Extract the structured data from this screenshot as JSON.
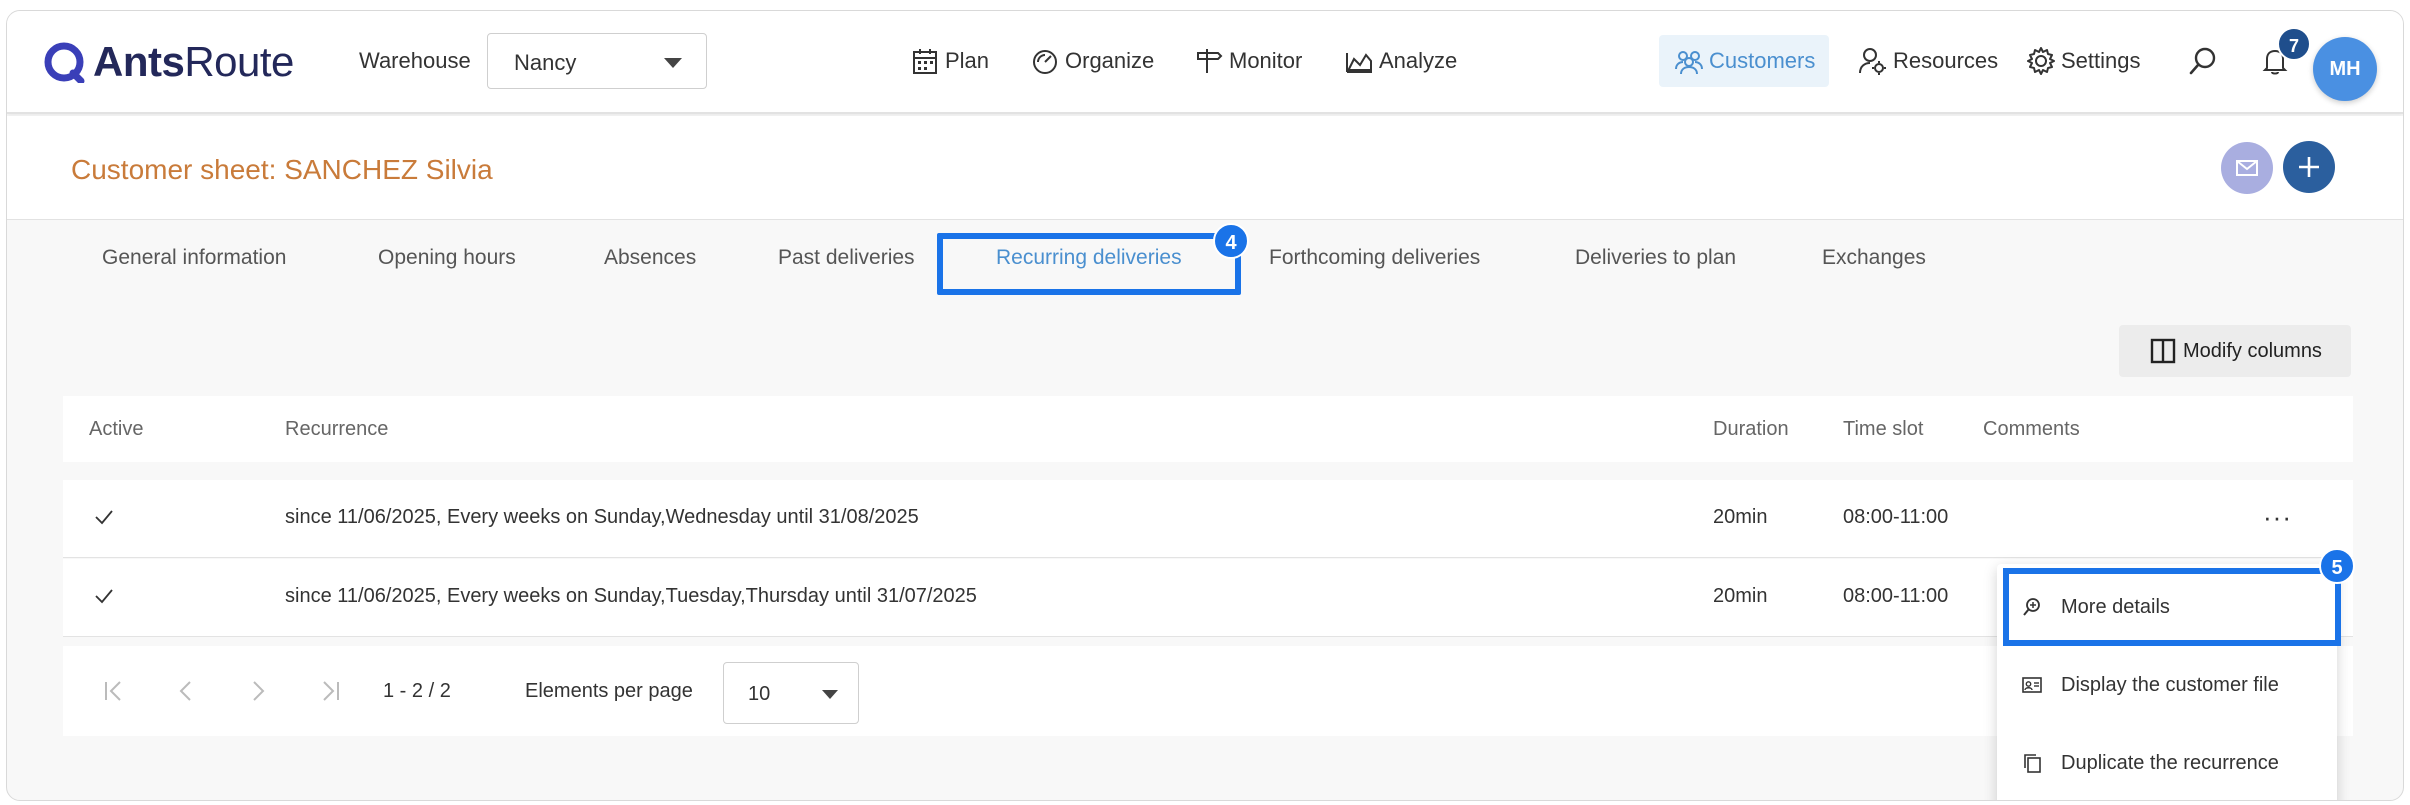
{
  "navbar": {
    "logo_bold": "Ants",
    "logo_light": "Route",
    "warehouse_label": "Warehouse",
    "warehouse_value": "Nancy",
    "items": [
      {
        "label": "Plan",
        "icon": "calendar-icon"
      },
      {
        "label": "Organize",
        "icon": "gauge-icon"
      },
      {
        "label": "Monitor",
        "icon": "signpost-icon"
      },
      {
        "label": "Analyze",
        "icon": "area-chart-icon"
      },
      {
        "label": "Customers",
        "icon": "users-icon"
      },
      {
        "label": "Resources",
        "icon": "user-gear-icon"
      },
      {
        "label": "Settings",
        "icon": "gear-icon"
      }
    ],
    "notification_count": "7",
    "avatar_initials": "MH"
  },
  "sheet": {
    "title": "Customer sheet: SANCHEZ Silvia"
  },
  "tabs": [
    "General information",
    "Opening hours",
    "Absences",
    "Past deliveries",
    "Recurring deliveries",
    "Forthcoming deliveries",
    "Deliveries to plan",
    "Exchanges"
  ],
  "active_tab": "Recurring deliveries",
  "markers": {
    "tab": "4",
    "menu": "5"
  },
  "modify_columns_label": "Modify columns",
  "table": {
    "columns": [
      "Active",
      "Recurrence",
      "Duration",
      "Time slot",
      "Comments"
    ],
    "rows": [
      {
        "active": true,
        "recurrence": "since 11/06/2025, Every weeks on Sunday,Wednesday until 31/08/2025",
        "duration": "20min",
        "time_slot": "08:00-11:00",
        "comments": ""
      },
      {
        "active": true,
        "recurrence": "since 11/06/2025, Every weeks on Sunday,Tuesday,Thursday until 31/07/2025",
        "duration": "20min",
        "time_slot": "08:00-11:00",
        "comments": ""
      }
    ]
  },
  "pager": {
    "range": "1 - 2 / 2",
    "per_page_label": "Elements per page",
    "per_page_value": "10"
  },
  "context_menu": {
    "items": [
      "More details",
      "Display the customer file",
      "Duplicate the recurrence"
    ]
  },
  "colors": {
    "accent": "#1a73e8",
    "brand_navy": "#23285a",
    "title_orange": "#c97b3a",
    "active_nav": "#4a8fcf"
  }
}
